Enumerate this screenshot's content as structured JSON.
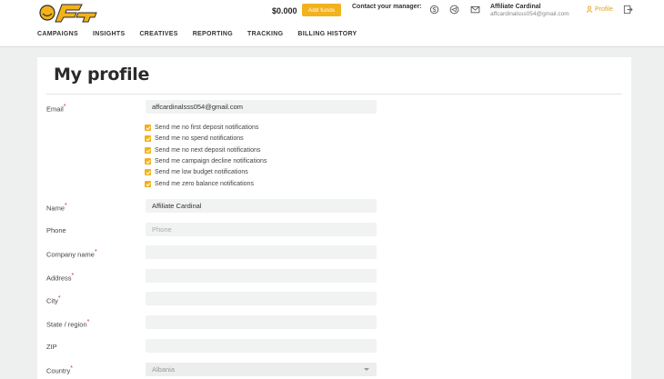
{
  "header": {
    "balance": "$0.000",
    "add_funds_label": "Add funds",
    "contact_label": "Contact your manager:",
    "contact_icons": [
      "skype-icon",
      "telegram-icon",
      "mail-icon"
    ],
    "user_name": "Affiliate Cardinal",
    "user_email": "affcardinalsss054@gmail.com",
    "profile_label": "Profile"
  },
  "nav": [
    "CAMPAIGNS",
    "INSIGHTS",
    "CREATIVES",
    "REPORTING",
    "TRACKING",
    "BILLING HISTORY"
  ],
  "page": {
    "title": "My profile"
  },
  "form": {
    "email_label": "Email",
    "email_value": "affcardinalsss054@gmail.com",
    "notifications": [
      {
        "label": "Send me no first deposit notifications",
        "checked": true
      },
      {
        "label": "Send me no spend notifications",
        "checked": true
      },
      {
        "label": "Send me no next deposit notifications",
        "checked": true
      },
      {
        "label": "Send me campaign decline notifications",
        "checked": true
      },
      {
        "label": "Send me low budget notifications",
        "checked": true
      },
      {
        "label": "Send me zero balance notifications",
        "checked": true
      }
    ],
    "name_label": "Name",
    "name_value": "Affiliate Cardinal",
    "phone_label": "Phone",
    "phone_placeholder": "Phone",
    "company_label": "Company name",
    "address_label": "Address",
    "city_label": "City",
    "state_label": "State / region",
    "zip_label": "ZIP",
    "country_label": "Country",
    "country_value": "Albania",
    "required_mark": "*"
  },
  "colors": {
    "accent": "#f2b21b",
    "profile_link": "#e2a21b"
  }
}
